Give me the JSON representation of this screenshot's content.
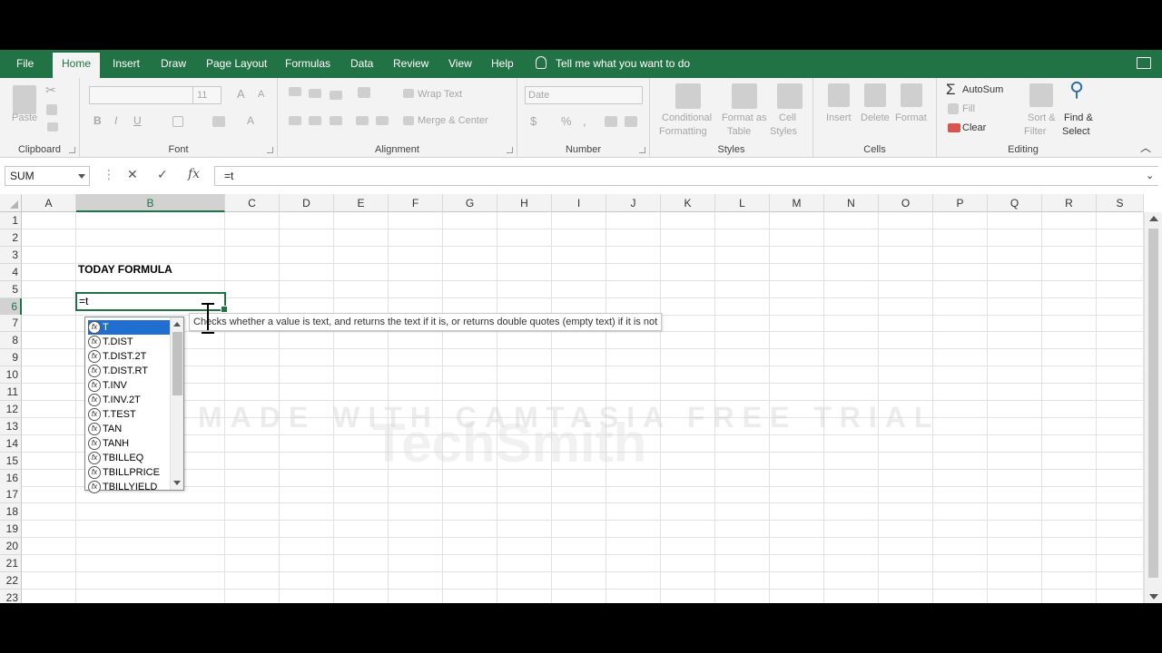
{
  "menubar": {
    "tabs": [
      "File",
      "Home",
      "Insert",
      "Draw",
      "Page Layout",
      "Formulas",
      "Data",
      "Review",
      "View",
      "Help"
    ],
    "active_tab": "Home",
    "tell_me": "Tell me what you want to do"
  },
  "ribbon": {
    "clipboard": {
      "paste": "Paste",
      "label": "Clipboard"
    },
    "font": {
      "size": "11",
      "label": "Font"
    },
    "alignment": {
      "wrap_text": "Wrap Text",
      "merge_center": "Merge & Center",
      "label": "Alignment"
    },
    "number": {
      "format": "Date",
      "label": "Number"
    },
    "styles": {
      "conditional": "Conditional",
      "formatting": "Formatting",
      "format_as": "Format as",
      "table": "Table",
      "cell": "Cell",
      "styles_word": "Styles",
      "label": "Styles"
    },
    "cells": {
      "insert": "Insert",
      "delete": "Delete",
      "format": "Format",
      "label": "Cells"
    },
    "editing": {
      "autosum": "AutoSum",
      "fill": "Fill",
      "clear": "Clear",
      "sort_filter": "Sort &",
      "filter": "Filter",
      "find": "Find &",
      "select": "Select",
      "label": "Editing"
    }
  },
  "formula_bar": {
    "name_box": "SUM",
    "formula": "=t"
  },
  "columns": [
    "A",
    "B",
    "C",
    "D",
    "E",
    "F",
    "G",
    "H",
    "I",
    "J",
    "K",
    "L",
    "M",
    "N",
    "O",
    "P",
    "Q",
    "R",
    "S"
  ],
  "rows": [
    "1",
    "2",
    "3",
    "4",
    "5",
    "6",
    "7",
    "8",
    "9",
    "10",
    "11",
    "12",
    "13",
    "14",
    "15",
    "16",
    "17",
    "18",
    "19",
    "20",
    "21",
    "22",
    "23"
  ],
  "cells": {
    "B4": "TODAY FORMULA",
    "B6": "=t"
  },
  "autocomplete": {
    "items": [
      "T",
      "T.DIST",
      "T.DIST.2T",
      "T.DIST.RT",
      "T.INV",
      "T.INV.2T",
      "T.TEST",
      "TAN",
      "TANH",
      "TBILLEQ",
      "TBILLPRICE",
      "TBILLYIELD"
    ],
    "selected": "T",
    "tooltip": "Checks whether a value is text, and returns the text if it is, or returns double quotes (empty text) if it is not"
  },
  "watermark": {
    "logo": "TechSmith",
    "line": "MADE WITH CAMTASIA FREE TRIAL"
  },
  "colors": {
    "accent": "#217346",
    "selection": "#1f6fd1"
  }
}
